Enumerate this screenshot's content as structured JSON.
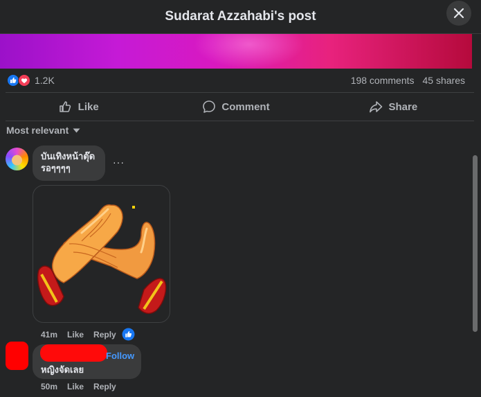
{
  "header": {
    "title": "Sudarat Azzahabi's post"
  },
  "stats": {
    "reactions_count": "1.2K",
    "comments": "198 comments",
    "shares": "45 shares"
  },
  "actions": [
    {
      "label": "Like",
      "icon": "thumbs-up-icon"
    },
    {
      "label": "Comment",
      "icon": "comment-icon"
    },
    {
      "label": "Share",
      "icon": "share-icon"
    }
  ],
  "sort": {
    "label": "Most relevant"
  },
  "comments": [
    {
      "text": "บันเทิงหน้าตุ๊ด\nรอๆๆๆๆ",
      "time": "41m",
      "like_label": "Like",
      "reply_label": "Reply",
      "sticker": "clapping-hands-sticker"
    },
    {
      "follow_label": "Follow",
      "text": "หญิงจัดเลย",
      "time": "50m",
      "like_label": "Like",
      "reply_label": "Reply"
    }
  ],
  "colors": {
    "background": "#242526",
    "bubble": "#3a3b3c",
    "like_blue": "#1877f2",
    "love_red": "#f33e58",
    "link": "#4599ff"
  }
}
